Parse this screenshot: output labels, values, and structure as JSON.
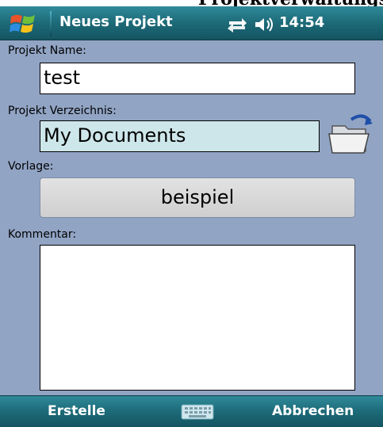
{
  "top_strip": {
    "partial_text": "Projektverwaltungsdialog"
  },
  "title_bar": {
    "title": "Neues Projekt",
    "time": "14:54"
  },
  "form": {
    "name_label": "Projekt Name:",
    "name_value": "test",
    "directory_label": "Projekt Verzeichnis:",
    "directory_value": "My Documents",
    "template_label": "Vorlage:",
    "template_value": "beispiel",
    "comment_label": "Kommentar:",
    "comment_value": ""
  },
  "menu_bar": {
    "left_softkey": "Erstelle",
    "right_softkey": "Abbrechen"
  },
  "icons": {
    "start": "windows-start-icon",
    "connectivity": "connectivity-icon",
    "volume": "volume-icon",
    "folder": "folder-open-icon",
    "keyboard": "keyboard-icon"
  },
  "colors": {
    "title_bar": "#1d6a78",
    "form_background": "#91a4c4",
    "directory_field": "#cde6ea"
  }
}
